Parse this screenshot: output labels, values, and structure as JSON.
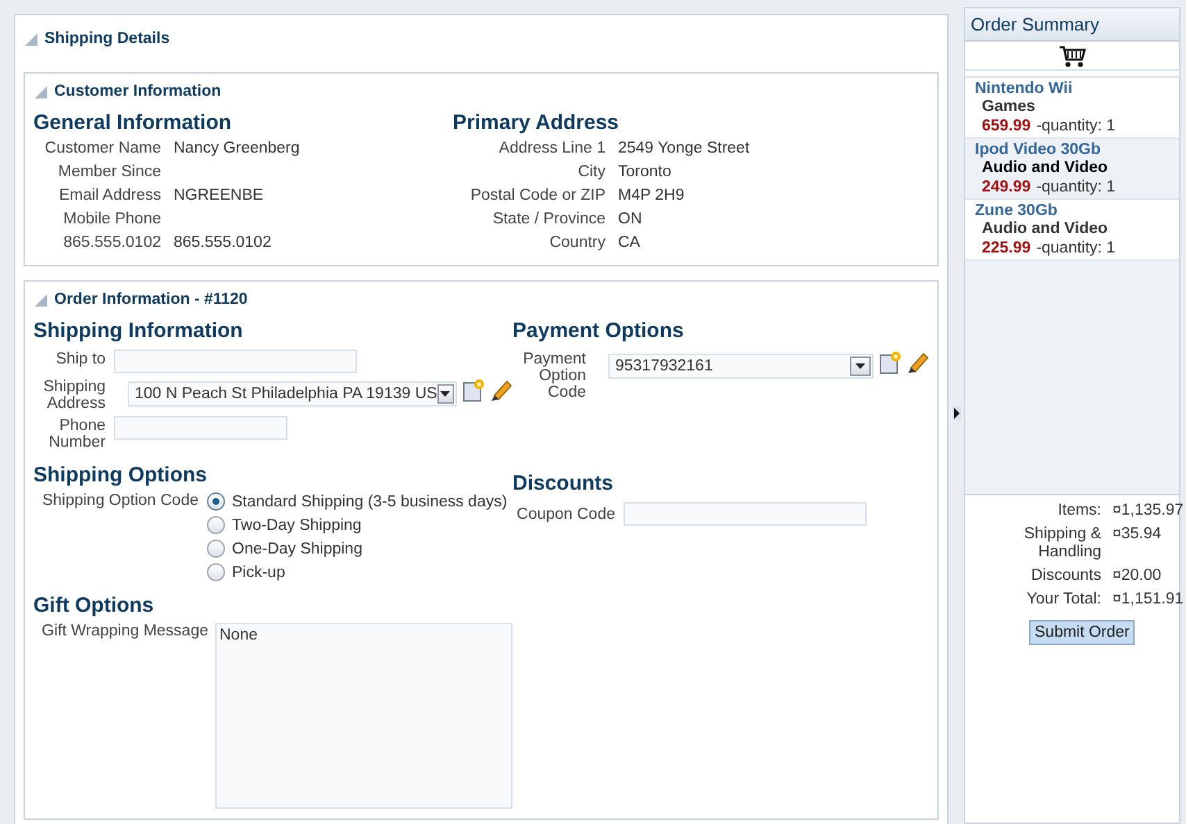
{
  "main_panel": {
    "title": "Shipping Details",
    "customer_section": {
      "title": "Customer Information",
      "general": {
        "heading": "General Information",
        "fields": [
          {
            "label": "Customer Name",
            "value": "Nancy Greenberg"
          },
          {
            "label": "Member Since"
          },
          {
            "label": "Email Address",
            "value": "NGREENBE"
          },
          {
            "label": "Mobile Phone"
          },
          {
            "label": "865.555.0102",
            "value": "865.555.0102"
          }
        ]
      },
      "address": {
        "heading": "Primary Address",
        "fields": [
          {
            "label": "Address Line 1",
            "value": "2549 Yonge Street"
          },
          {
            "label": "City",
            "value": "Toronto"
          },
          {
            "label": "Postal Code or ZIP",
            "value": "M4P 2H9"
          },
          {
            "label": "State / Province",
            "value": "ON"
          },
          {
            "label": "Country",
            "value": "CA"
          }
        ]
      }
    },
    "order_section": {
      "title": "Order Information - #1120",
      "shipping_info": {
        "heading": "Shipping Information",
        "ship_to": {
          "label": "Ship to"
        },
        "shipping_address": {
          "label": "Shipping Address",
          "value": "100 N Peach St Philadelphia PA 19139 US"
        },
        "phone": {
          "label": "Phone Number"
        }
      },
      "payment": {
        "heading": "Payment Options",
        "label": "Payment Option Code",
        "value": "95317932161"
      },
      "shipping_options": {
        "heading": "Shipping Options",
        "label": "Shipping Option Code",
        "options": [
          {
            "label": "Standard Shipping (3-5 business days)",
            "selected": true
          },
          {
            "label": "Two-Day Shipping",
            "selected": false
          },
          {
            "label": "One-Day Shipping",
            "selected": false
          },
          {
            "label": "Pick-up",
            "selected": false
          }
        ]
      },
      "discounts": {
        "heading": "Discounts",
        "label": "Coupon Code"
      },
      "gift": {
        "heading": "Gift Options",
        "label": "Gift Wrapping Message",
        "value": "None"
      }
    }
  },
  "order_summary": {
    "title": "Order Summary",
    "items": [
      {
        "name": "Nintendo Wii",
        "category": "Games",
        "price": "659.99",
        "quantity": "-quantity: 1",
        "selected": false
      },
      {
        "name": "Ipod Video 30Gb",
        "category": "Audio and Video",
        "price": "249.99",
        "quantity": "-quantity: 1",
        "selected": true
      },
      {
        "name": "Zune 30Gb",
        "category": "Audio and Video",
        "price": "225.99",
        "quantity": "-quantity: 1",
        "selected": false
      }
    ],
    "totals": [
      {
        "label": "Items:",
        "value": "¤1,135.97"
      },
      {
        "label": "Shipping & Handling",
        "value": "¤35.94"
      },
      {
        "label": "Discounts",
        "value": "¤20.00"
      },
      {
        "label": "Your Total:",
        "value": "¤1,151.91"
      }
    ],
    "submit": "Submit Order"
  }
}
